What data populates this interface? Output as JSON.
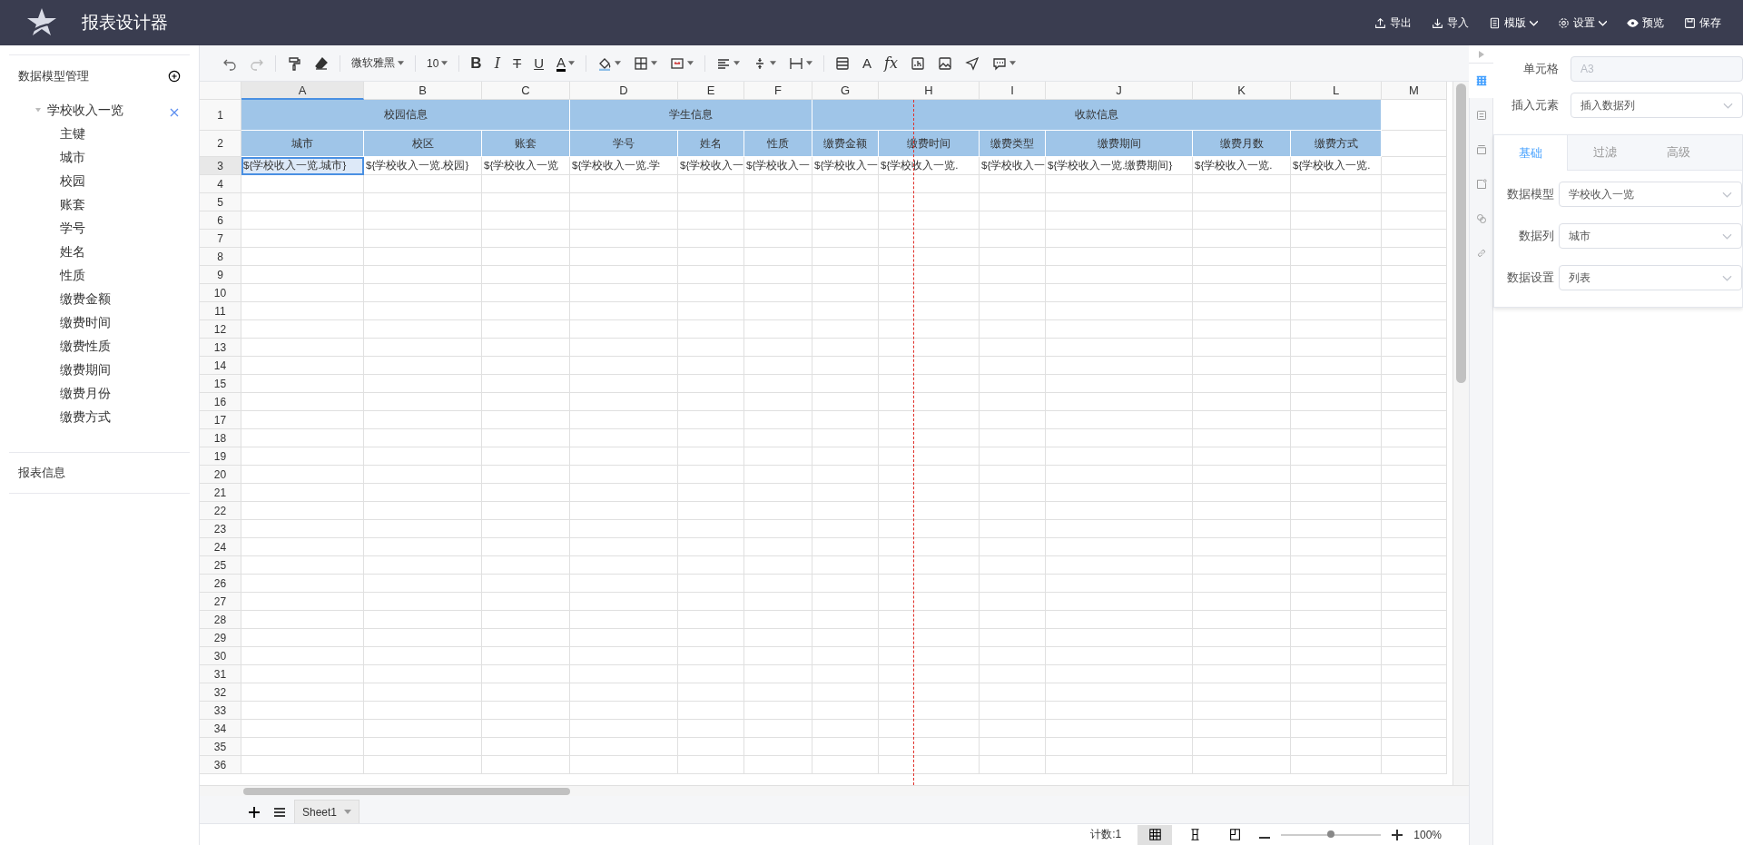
{
  "header": {
    "title": "报表设计器",
    "actions": [
      {
        "kind": "export",
        "label": "导出",
        "dropdown": false
      },
      {
        "kind": "import",
        "label": "导入",
        "dropdown": false
      },
      {
        "kind": "template",
        "label": "模版",
        "dropdown": true
      },
      {
        "kind": "settings",
        "label": "设置",
        "dropdown": true
      },
      {
        "kind": "preview",
        "label": "预览",
        "dropdown": false
      },
      {
        "kind": "save",
        "label": "保存",
        "dropdown": false
      }
    ]
  },
  "sidebar": {
    "model_title": "数据模型管理",
    "tree": [
      {
        "label": "学校收入一览",
        "expanded": true,
        "children": [
          {
            "label": "主键"
          },
          {
            "label": "城市"
          },
          {
            "label": "校园"
          },
          {
            "label": "账套"
          },
          {
            "label": "学号"
          },
          {
            "label": "姓名"
          },
          {
            "label": "性质"
          },
          {
            "label": "缴费金额"
          },
          {
            "label": "缴费时间"
          },
          {
            "label": "缴费性质"
          },
          {
            "label": "缴费期间"
          },
          {
            "label": "缴费月份"
          },
          {
            "label": "缴费方式"
          }
        ]
      }
    ],
    "report_title": "报表信息"
  },
  "toolbar": [
    {
      "kind": "undo"
    },
    {
      "kind": "redo"
    },
    {
      "kind": "separator"
    },
    {
      "kind": "paint-format"
    },
    {
      "kind": "eraser"
    },
    {
      "kind": "separator"
    },
    {
      "kind": "font-select",
      "text": "微软雅黑"
    },
    {
      "kind": "separator"
    },
    {
      "kind": "size-select",
      "text": "10"
    },
    {
      "kind": "separator"
    },
    {
      "kind": "bold",
      "text": "B"
    },
    {
      "kind": "italic",
      "text": "I"
    },
    {
      "kind": "strike",
      "text": "T"
    },
    {
      "kind": "underline",
      "text": "U"
    },
    {
      "kind": "font-color",
      "text": "A",
      "dropdown": true
    },
    {
      "kind": "separator"
    },
    {
      "kind": "fill",
      "dropdown": true
    },
    {
      "kind": "border",
      "dropdown": true
    },
    {
      "kind": "merge",
      "dropdown": true
    },
    {
      "kind": "separator"
    },
    {
      "kind": "align",
      "dropdown": true
    },
    {
      "kind": "valign",
      "dropdown": true
    },
    {
      "kind": "wrap",
      "dropdown": true
    },
    {
      "kind": "separator"
    },
    {
      "kind": "rows"
    },
    {
      "kind": "font",
      "text": "A"
    },
    {
      "kind": "formula",
      "text": "fx"
    },
    {
      "kind": "chart"
    },
    {
      "kind": "image"
    },
    {
      "kind": "send"
    },
    {
      "kind": "comment",
      "dropdown": true
    }
  ],
  "sheet": {
    "columns": [
      {
        "label": "A",
        "selected": true
      },
      {
        "label": "B",
        "selected": false
      },
      {
        "label": "C",
        "selected": false
      },
      {
        "label": "D",
        "selected": false
      },
      {
        "label": "E",
        "selected": false
      },
      {
        "label": "F",
        "selected": false
      },
      {
        "label": "G",
        "selected": false
      },
      {
        "label": "H",
        "selected": false
      },
      {
        "label": "I",
        "selected": false
      },
      {
        "label": "J",
        "selected": false
      },
      {
        "label": "K",
        "selected": false
      },
      {
        "label": "L",
        "selected": false
      },
      {
        "label": "M",
        "selected": false
      }
    ],
    "row_numbers": [
      {
        "label": "1",
        "selected": false
      },
      {
        "label": "2",
        "selected": false
      },
      {
        "label": "3",
        "selected": true
      },
      {
        "label": "4",
        "selected": false
      },
      {
        "label": "5",
        "selected": false
      },
      {
        "label": "6",
        "selected": false
      },
      {
        "label": "7",
        "selected": false
      },
      {
        "label": "8",
        "selected": false
      },
      {
        "label": "9",
        "selected": false
      },
      {
        "label": "10",
        "selected": false
      },
      {
        "label": "11",
        "selected": false
      },
      {
        "label": "12",
        "selected": false
      },
      {
        "label": "13",
        "selected": false
      },
      {
        "label": "14",
        "selected": false
      },
      {
        "label": "15",
        "selected": false
      },
      {
        "label": "16",
        "selected": false
      },
      {
        "label": "17",
        "selected": false
      },
      {
        "label": "18",
        "selected": false
      },
      {
        "label": "19",
        "selected": false
      },
      {
        "label": "20",
        "selected": false
      },
      {
        "label": "21",
        "selected": false
      },
      {
        "label": "22",
        "selected": false
      },
      {
        "label": "23",
        "selected": false
      },
      {
        "label": "24",
        "selected": false
      },
      {
        "label": "25",
        "selected": false
      },
      {
        "label": "26",
        "selected": false
      },
      {
        "label": "27",
        "selected": false
      },
      {
        "label": "28",
        "selected": false
      },
      {
        "label": "29",
        "selected": false
      },
      {
        "label": "30",
        "selected": false
      },
      {
        "label": "31",
        "selected": false
      },
      {
        "label": "32",
        "selected": false
      },
      {
        "label": "33",
        "selected": false
      },
      {
        "label": "34",
        "selected": false
      },
      {
        "label": "35",
        "selected": false
      },
      {
        "label": "36",
        "selected": false
      }
    ],
    "header_groups": [
      {
        "title": "校园信息",
        "fields": [
          {
            "header": "城市",
            "binding": "${学校收入一览.城市}",
            "selected": true
          },
          {
            "header": "校区",
            "binding": "${学校收入一览.校园}",
            "selected": false
          },
          {
            "header": "账套",
            "binding": "${学校收入一览",
            "selected": false
          }
        ]
      },
      {
        "title": "学生信息",
        "fields": [
          {
            "header": "学号",
            "binding": "${学校收入一览.学",
            "selected": false
          },
          {
            "header": "姓名",
            "binding": "${学校收入一",
            "selected": false
          },
          {
            "header": "性质",
            "binding": "${学校收入一",
            "selected": false
          }
        ]
      },
      {
        "title": "收款信息",
        "fields": [
          {
            "header": "缴费金额",
            "binding": "${学校收入一",
            "selected": false
          },
          {
            "header": "缴费时间",
            "binding": "${学校收入一览.",
            "selected": false
          },
          {
            "header": "缴费类型",
            "binding": "${学校收入一",
            "selected": false
          },
          {
            "header": "缴费期间",
            "binding": "${学校收入一览.缴费期间}",
            "selected": false
          },
          {
            "header": "缴费月数",
            "binding": "${学校收入一览.",
            "selected": false
          },
          {
            "header": "缴费方式",
            "binding": "${学校收入一览.",
            "selected": false
          }
        ]
      }
    ],
    "tabs": [
      {
        "label": "Sheet1",
        "selected": true
      }
    ]
  },
  "status_bar": {
    "count": "计数:1",
    "views": [
      {
        "kind": "normal",
        "selected": true
      },
      {
        "kind": "page-break",
        "selected": false
      },
      {
        "kind": "page-layout",
        "selected": false
      }
    ],
    "zoom_level": {
      "level": 0.5
    },
    "zoom": "100%"
  },
  "side_strip": [
    {
      "kind": "cell",
      "selected": true
    },
    {
      "kind": "form",
      "selected": false
    },
    {
      "kind": "layer",
      "selected": false
    },
    {
      "kind": "page",
      "selected": false
    },
    {
      "kind": "group",
      "selected": false
    },
    {
      "kind": "link",
      "selected": false
    }
  ],
  "properties": {
    "cell_label": "单元格",
    "cell_value": "A3",
    "insert_label": "插入元素",
    "insert_value": "插入数据列",
    "tabs": [
      {
        "label": "基础",
        "selected": true
      },
      {
        "label": "过滤",
        "selected": false
      },
      {
        "label": "高级",
        "selected": false
      }
    ],
    "fields": [
      {
        "label": "数据模型",
        "value": "学校收入一览"
      },
      {
        "label": "数据列",
        "value": "城市"
      },
      {
        "label": "数据设置",
        "value": "列表"
      }
    ]
  }
}
